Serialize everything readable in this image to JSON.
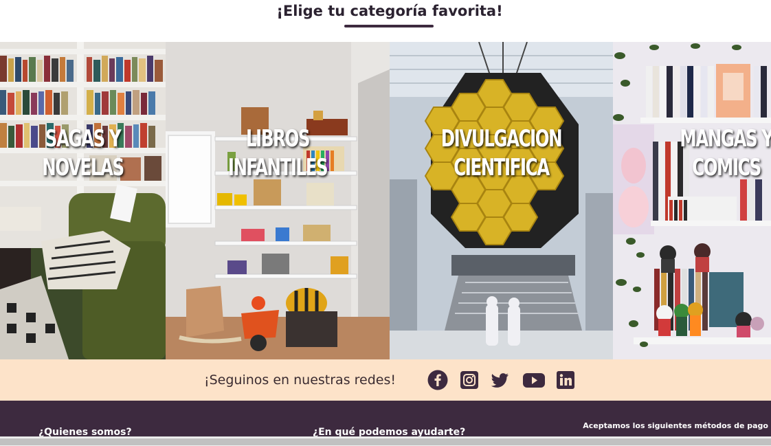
{
  "section": {
    "title": "¡Elige tu categoría favorita!"
  },
  "categories": [
    {
      "label_line1": "SAGAS Y",
      "label_line2": "NOVELAS"
    },
    {
      "label_line1": "LIBROS",
      "label_line2": "INFANTILES"
    },
    {
      "label_line1": "DIVULGACION",
      "label_line2": "CIENTIFICA"
    },
    {
      "label_line1": "MANGAS Y",
      "label_line2": "COMICS"
    }
  ],
  "social": {
    "text": "¡Seguinos en nuestras redes!",
    "icons": [
      "facebook-icon",
      "instagram-icon",
      "twitter-icon",
      "youtube-icon",
      "linkedin-icon"
    ],
    "color": "#3d2a3f"
  },
  "footer": {
    "about_title": "¿Quienes somos?",
    "help_title": "¿En qué podemos ayudarte?",
    "payment_title": "Aceptamos los siguientes métodos de pago"
  },
  "colors": {
    "brand": "#3d2a3f",
    "social_bg": "#fde3c9"
  }
}
